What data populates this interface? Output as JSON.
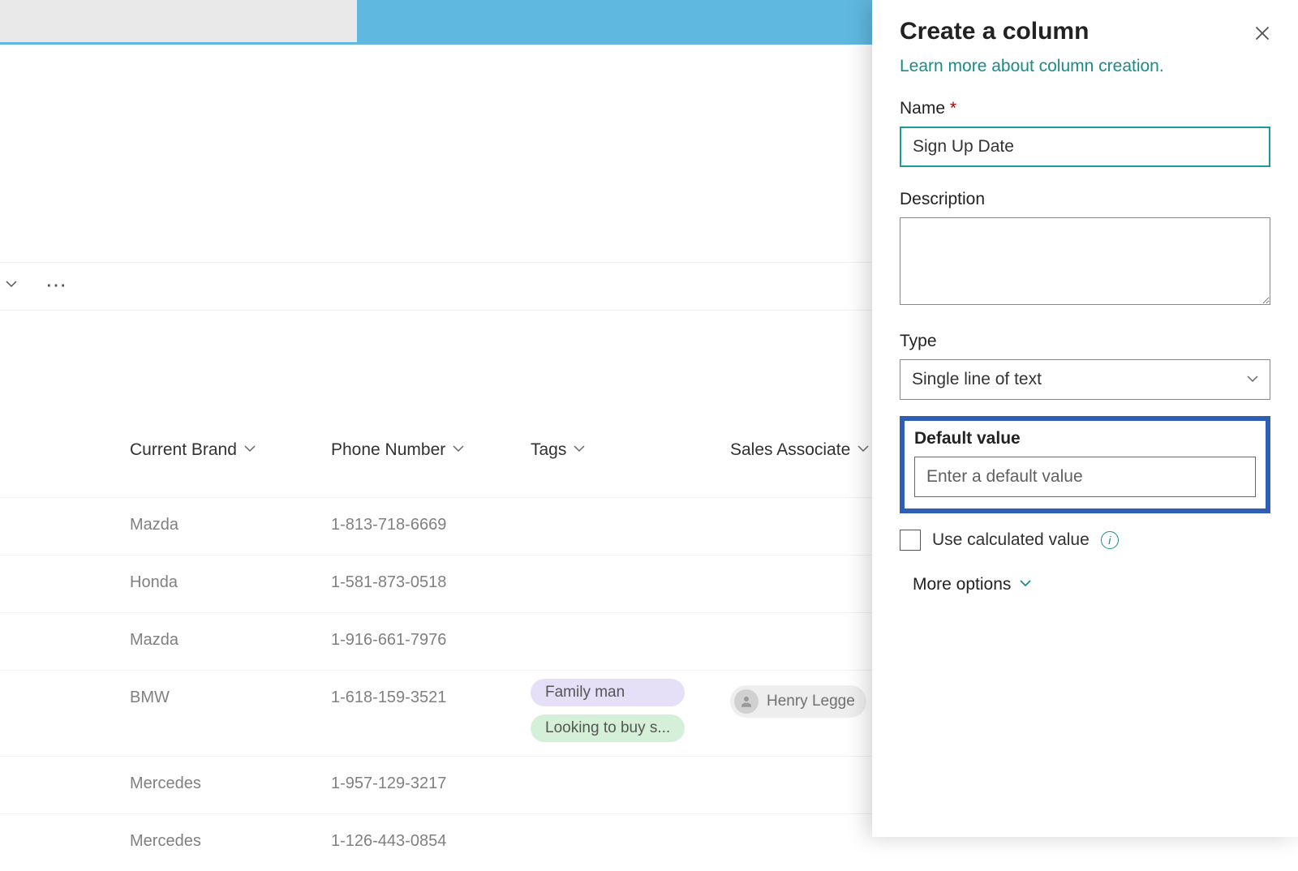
{
  "topbar": {
    "search_value": ""
  },
  "toolbar": {
    "ellipsis": "⋯"
  },
  "columns": {
    "brand": "Current Brand",
    "phone": "Phone Number",
    "tags": "Tags",
    "sales": "Sales Associate"
  },
  "rows": [
    {
      "brand": "Mazda",
      "phone": "1-813-718-6669",
      "tags": [],
      "sales": ""
    },
    {
      "brand": "Honda",
      "phone": "1-581-873-0518",
      "tags": [],
      "sales": ""
    },
    {
      "brand": "Mazda",
      "phone": "1-916-661-7976",
      "tags": [],
      "sales": ""
    },
    {
      "brand": "BMW",
      "phone": "1-618-159-3521",
      "tags": [
        "Family man",
        "Looking to buy s..."
      ],
      "sales": "Henry Legge"
    },
    {
      "brand": "Mercedes",
      "phone": "1-957-129-3217",
      "tags": [],
      "sales": ""
    },
    {
      "brand": "Mercedes",
      "phone": "1-126-443-0854",
      "tags": [],
      "sales": ""
    }
  ],
  "panel": {
    "title": "Create a column",
    "learn_link": "Learn more about column creation.",
    "name_label": "Name",
    "name_value": "Sign Up Date",
    "desc_label": "Description",
    "desc_value": "",
    "type_label": "Type",
    "type_value": "Single line of text",
    "default_label": "Default value",
    "default_placeholder": "Enter a default value",
    "default_value": "",
    "calc_label": "Use calculated value",
    "more_label": "More options"
  }
}
